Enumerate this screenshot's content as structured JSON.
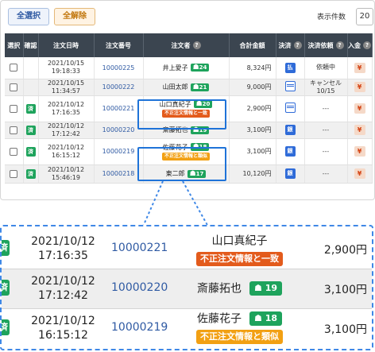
{
  "toolbar": {
    "select_all": "全選択",
    "clear_all": "全解除",
    "count_label": "表示件数",
    "count_value": "20"
  },
  "columns": {
    "select": "選択",
    "confirm": "確認",
    "order_datetime": "注文日時",
    "order_no": "注文番号",
    "name": "注文者",
    "total": "合計金額",
    "payment": "決済",
    "settle_req": "決済依頼",
    "deposit": "入金"
  },
  "rows": [
    {
      "checked_label": "",
      "date": "2021/10/15",
      "time": "19:18:33",
      "order_no": "10000225",
      "name": "井上愛子",
      "age": "24",
      "warning": "",
      "total": "8,324円",
      "payment_icon": "barcode-payment-icon",
      "request": "依頼中",
      "request2": "",
      "deposit": "¥"
    },
    {
      "checked_label": "",
      "date": "2021/10/15",
      "time": "11:34:57",
      "order_no": "10000222",
      "name": "山田太郎",
      "age": "21",
      "warning": "",
      "total": "9,000円",
      "payment_icon": "card-payment-icon",
      "request": "キャンセル",
      "request2": "10/15",
      "deposit": "¥"
    },
    {
      "checked_label": "済",
      "date": "2021/10/12",
      "time": "17:16:35",
      "order_no": "10000221",
      "name": "山口真紀子",
      "age": "20",
      "warning": "不正注文情報と一致",
      "total": "2,900円",
      "payment_icon": "card-payment-icon",
      "request": "---",
      "request2": "",
      "deposit": "¥"
    },
    {
      "checked_label": "済",
      "date": "2021/10/12",
      "time": "17:12:42",
      "order_no": "10000220",
      "name": "斎藤拓也",
      "age": "19",
      "warning": "",
      "total": "3,100円",
      "payment_icon": "bank-payment-icon",
      "request": "---",
      "request2": "",
      "deposit": "¥"
    },
    {
      "checked_label": "済",
      "date": "2021/10/12",
      "time": "16:15:12",
      "order_no": "10000219",
      "name": "佐藤花子",
      "age": "18",
      "warning": "不正注文情報と類似",
      "total": "3,100円",
      "payment_icon": "bank-payment-icon",
      "request": "---",
      "request2": "",
      "deposit": "¥"
    },
    {
      "checked_label": "済",
      "date": "2021/10/12",
      "time": "15:46:19",
      "order_no": "10000218",
      "name": "東二郎",
      "age": "17",
      "warning": "",
      "total": "10,120円",
      "payment_icon": "bank-payment-icon",
      "request": "---",
      "request2": "",
      "deposit": "¥"
    }
  ],
  "payment_glyphs": {
    "barcode": "払",
    "bank": "銀"
  },
  "zoom": [
    {
      "check": "済",
      "date": "2021/10/12",
      "time": "17:16:35",
      "order_no": "10000221",
      "name": "山口真紀子",
      "age": "",
      "warning": "不正注文情報と一致",
      "total": "2,900円"
    },
    {
      "check": "済",
      "date": "2021/10/12",
      "time": "17:12:42",
      "order_no": "10000220",
      "name": "斎藤拓也",
      "age": "19",
      "warning": "",
      "total": "3,100円"
    },
    {
      "check": "済",
      "date": "2021/10/12",
      "time": "16:15:12",
      "order_no": "10000219",
      "name": "佐藤花子",
      "age": "18",
      "warning": "不正注文情報と類似",
      "total": "3,100円"
    }
  ],
  "colors": {
    "header_bg": "#3b4550",
    "highlight_border": "#1f73d8",
    "warning_red": "#e35b1c",
    "warning_orange": "#f2a013",
    "age_badge": "#1ea35c",
    "order_link": "#2f5aa3"
  }
}
